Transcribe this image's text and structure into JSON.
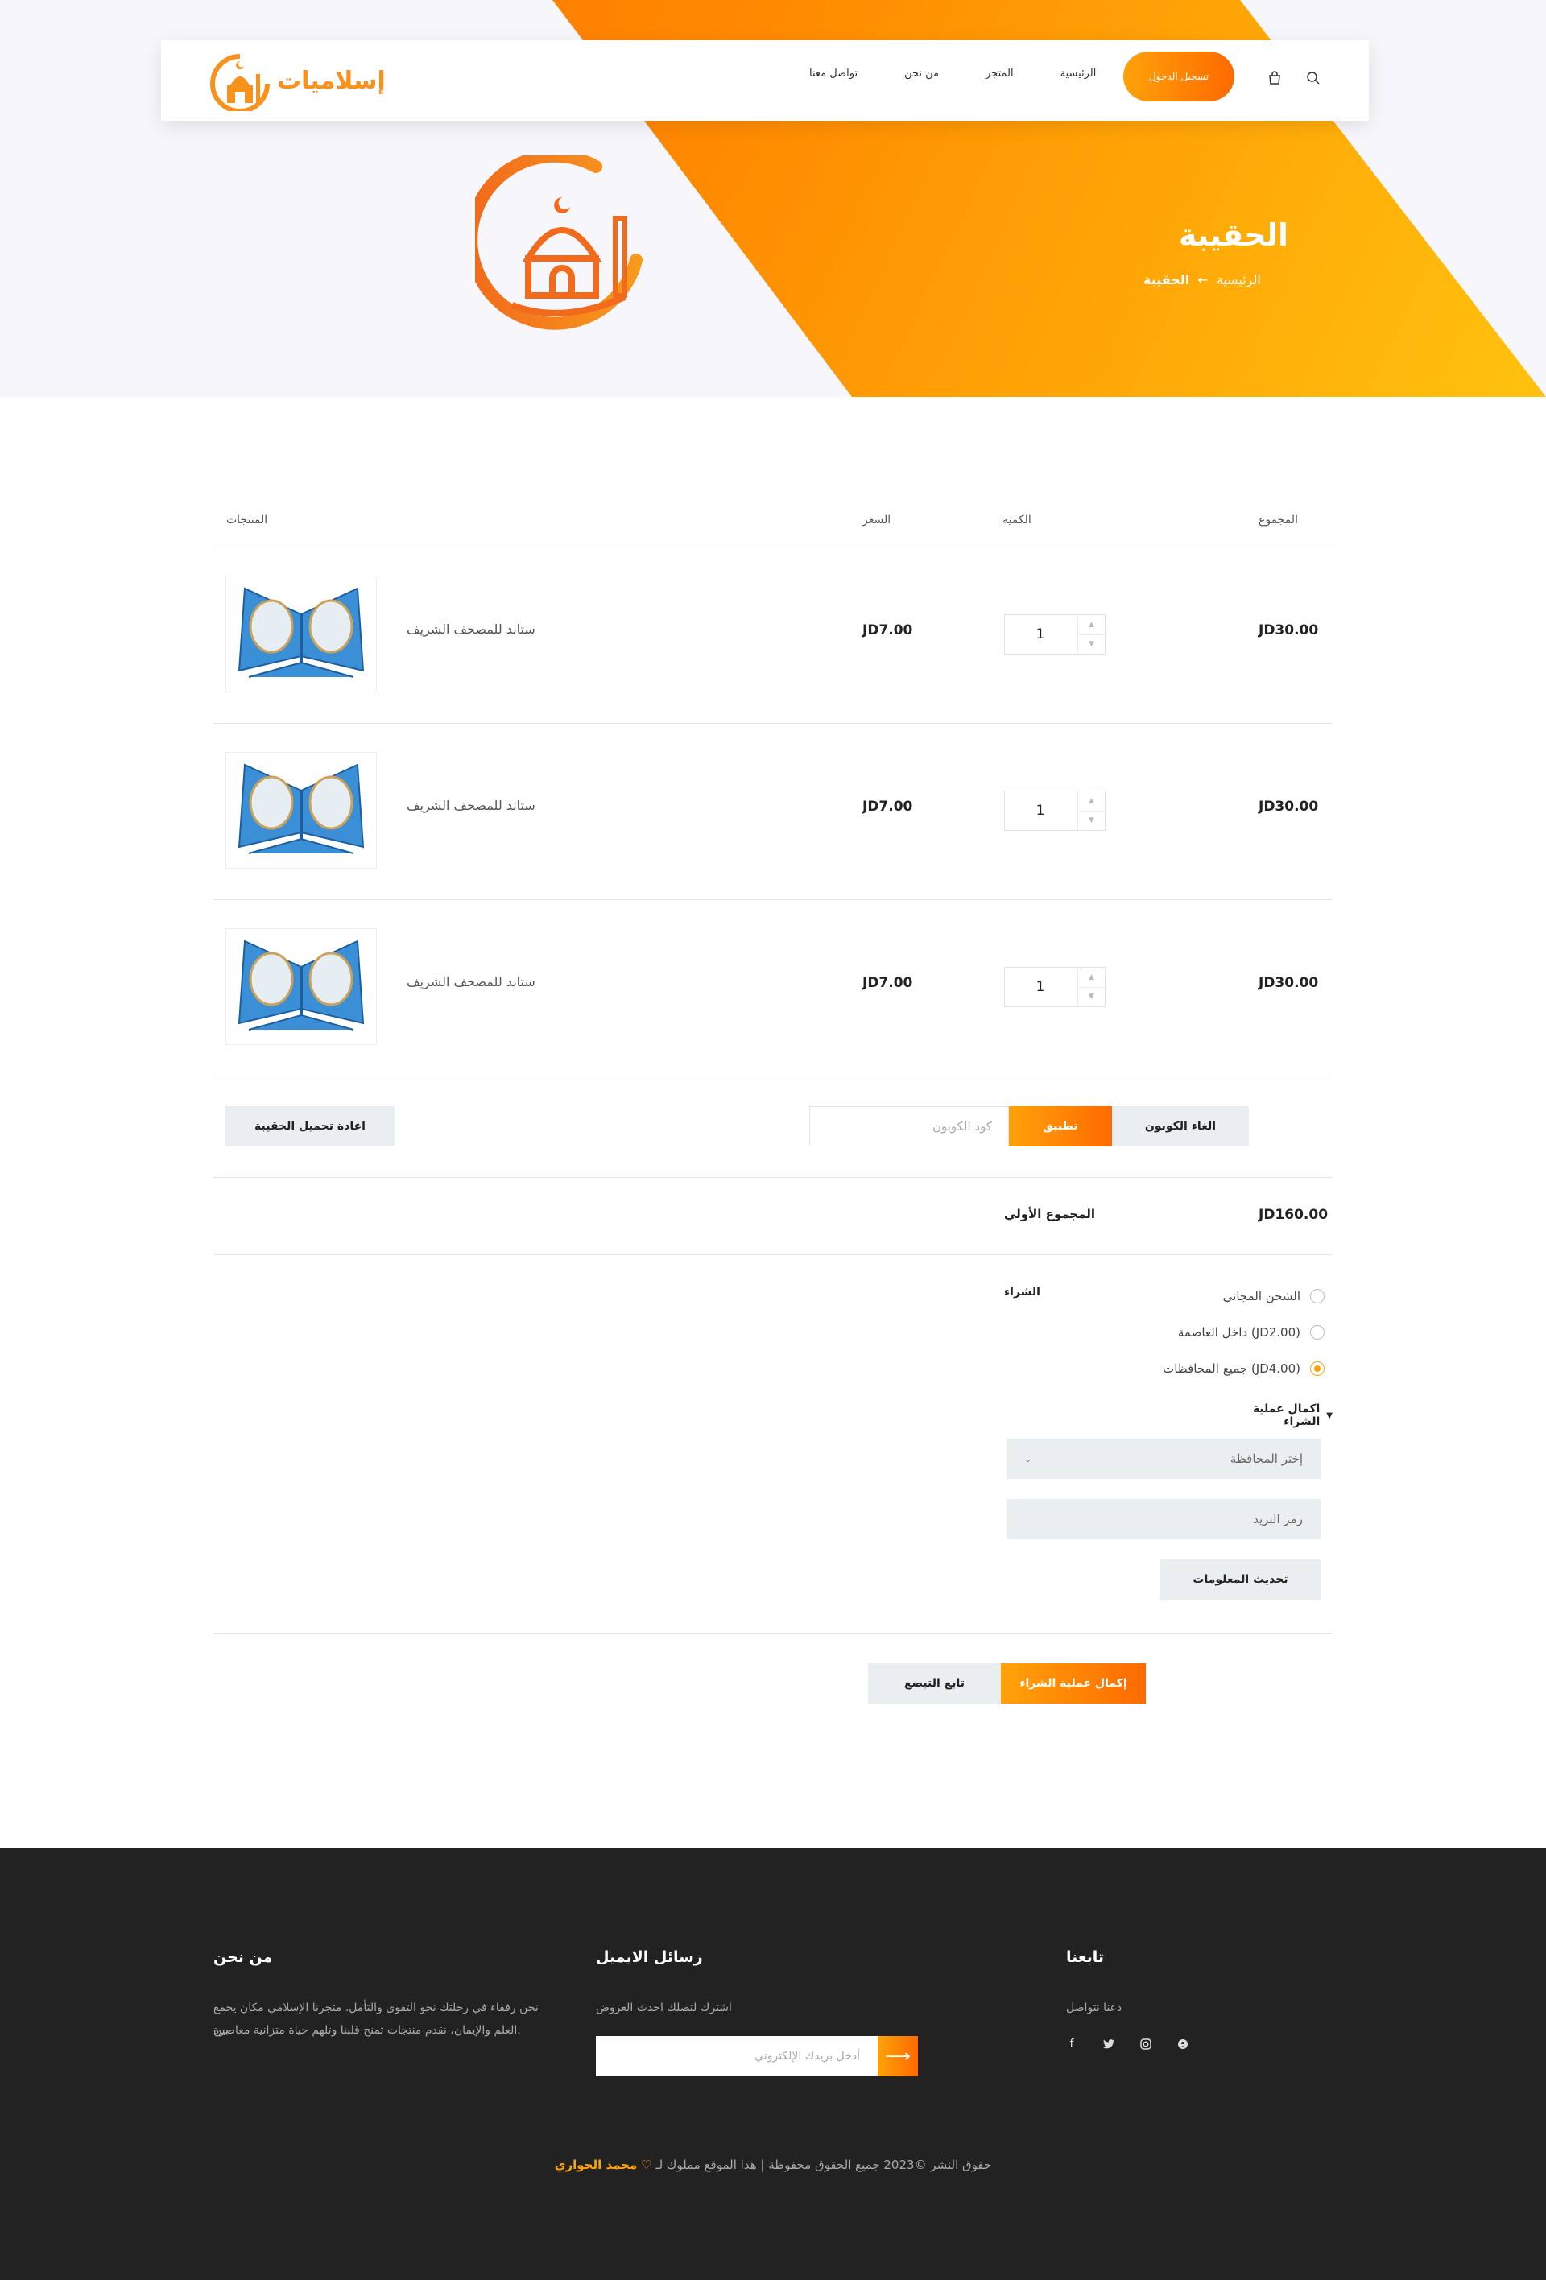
{
  "header": {
    "logo_text": "إسلاميات",
    "nav": [
      "تواصل معنا",
      "من نحن",
      "المتجر",
      "الرئيسية"
    ],
    "login_label": "تسجيل الدخول"
  },
  "hero": {
    "title": "الحقيبة",
    "breadcrumb_home": "الرئيسية",
    "breadcrumb_current": "الحقيبة"
  },
  "table": {
    "col_products": "المنتجات",
    "col_price": "السعر",
    "col_qty": "الكمية",
    "col_total": "المجموع",
    "rows": [
      {
        "name": "ستاند للمصحف الشريف",
        "price": "JD7.00",
        "qty": "1",
        "total": "JD30.00"
      },
      {
        "name": "ستاند للمصحف الشريف",
        "price": "JD7.00",
        "qty": "1",
        "total": "JD30.00"
      },
      {
        "name": "ستاند للمصحف الشريف",
        "price": "JD7.00",
        "qty": "1",
        "total": "JD30.00"
      }
    ]
  },
  "actions": {
    "reload_cart": "اعادة تحميل الحقيبة",
    "coupon_placeholder": "كود الكوبون",
    "apply": "تطبيق",
    "cancel_coupon": "الغاء الكوبون"
  },
  "summary": {
    "subtotal_label": "المجموع الأولي",
    "subtotal_value": "JD160.00",
    "purchase_label": "الشراء",
    "shipping_options": [
      {
        "label": "الشحن المجاني",
        "selected": false
      },
      {
        "label": "(JD2.00) داخل العاصمة",
        "selected": false
      },
      {
        "label": "(JD4.00) جميع المحافظات",
        "selected": true
      }
    ],
    "complete_toggle": "اكمال عملية الشراء",
    "governorate_placeholder": "إختر المحافظة",
    "zip_placeholder": "رمز البريد",
    "update_info": "تحديث المعلومات"
  },
  "checkout": {
    "complete_purchase": "إكمال عملية الشراء",
    "continue_shopping": "تابع التبضع"
  },
  "footer": {
    "about_title": "من نحن",
    "about_text_1": "نحن رفقاء في رحلتك نحو التقوى والتأمل. متجرنا الإسلامي مكان يجمع بين",
    "about_text_2": ".العلم والإيمان، نقدم منتجات تمنح قلبنا وتلهم حياة متزانية معاصرة",
    "newsletter_title": "رسائل الايميل",
    "newsletter_text": "اشترك لتصلك احدث العروض",
    "email_placeholder": "أدخل بريدك الإلكتروني",
    "follow_title": "تابعنا",
    "follow_text": "دعنا نتواصل",
    "copyright": "حقوق النشر ©2023 جميع الحقوق محفوظة | هذا الموقع مملوك لـ",
    "owner": "محمد الحواري"
  },
  "colors": {
    "accent_start": "#ffa20a",
    "accent_end": "#ff6a00",
    "footer_bg": "#222222"
  }
}
